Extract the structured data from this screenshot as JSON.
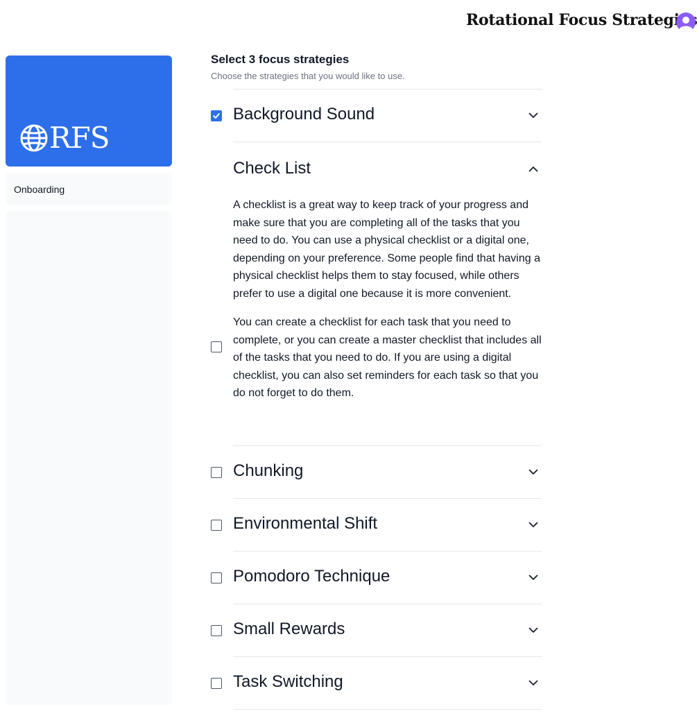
{
  "header": {
    "app_title": "Rotational Focus Strategies"
  },
  "sidebar": {
    "logo_text": "RFS",
    "nav_items": [
      {
        "label": "Onboarding"
      }
    ]
  },
  "main": {
    "heading": "Select 3 focus strategies",
    "subheading": "Choose the strategies that you would like to use.",
    "strategies": [
      {
        "title": "Background Sound",
        "checked": true,
        "expanded": false
      },
      {
        "title": "Check List",
        "checked": false,
        "expanded": true,
        "description": [
          "A checklist is a great way to keep track of your progress and make sure that you are completing all of the tasks that you need to do. You can use a physical checklist or a digital one, depending on your preference. Some people find that having a physical checklist helps them to stay focused, while others prefer to use a digital one because it is more convenient.",
          "You can create a checklist for each task that you need to complete, or you can create a master checklist that includes all of the tasks that you need to do. If you are using a digital checklist, you can also set reminders for each task so that you do not forget to do them."
        ]
      },
      {
        "title": "Chunking",
        "checked": false,
        "expanded": false
      },
      {
        "title": "Environmental Shift",
        "checked": false,
        "expanded": false
      },
      {
        "title": "Pomodoro Technique",
        "checked": false,
        "expanded": false
      },
      {
        "title": "Small Rewards",
        "checked": false,
        "expanded": false
      },
      {
        "title": "Task Switching",
        "checked": false,
        "expanded": false
      }
    ]
  },
  "colors": {
    "brand": "#2d6fea",
    "avatar": "#8b5cf6",
    "sidebar_bg": "#f9fafb",
    "divider": "#e5e7eb"
  },
  "icons": {
    "logo": "globe-icon",
    "avatar": "user-avatar-icon",
    "expand": "chevron-down-icon",
    "collapse": "chevron-up-icon",
    "checked": "checkmark-icon"
  }
}
